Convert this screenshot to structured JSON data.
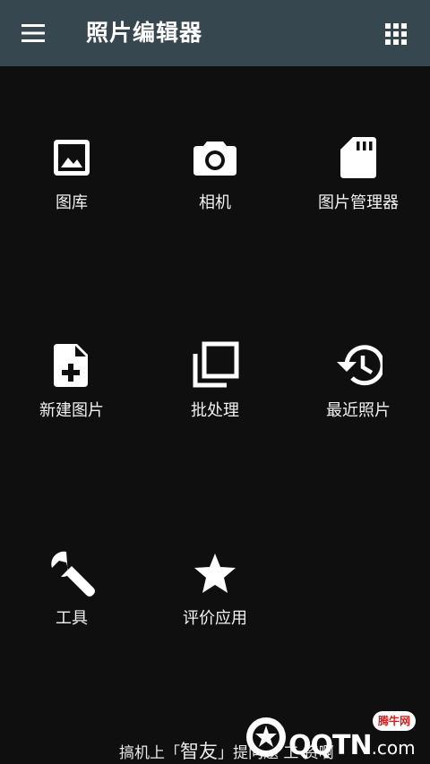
{
  "appbar": {
    "title": "照片编辑器",
    "menu_icon": "hamburger-menu-icon",
    "apps_icon": "grid-apps-icon"
  },
  "tiles": [
    {
      "label": "图库",
      "icon": "image-icon"
    },
    {
      "label": "相机",
      "icon": "camera-icon"
    },
    {
      "label": "图片管理器",
      "icon": "sd-card-icon"
    },
    {
      "label": "新建图片",
      "icon": "note-add-icon"
    },
    {
      "label": "批处理",
      "icon": "library-stack-icon"
    },
    {
      "label": "最近照片",
      "icon": "history-icon"
    },
    {
      "label": "工具",
      "icon": "wrench-icon"
    },
    {
      "label": "评价应用",
      "icon": "star-icon"
    }
  ],
  "footer": {
    "prefix": "搞机上",
    "brand_open": "「",
    "brand": "智友",
    "brand_close": "」",
    "suffix": "提问题 工 资啊"
  },
  "watermark": {
    "brand": "QQTN",
    "domain": ".com",
    "bubble": "腾牛网"
  },
  "colors": {
    "appbar": "#37474f",
    "background": "#0f0f0f",
    "icon": "#ffffff",
    "watermark_accent": "#d61d1d"
  }
}
